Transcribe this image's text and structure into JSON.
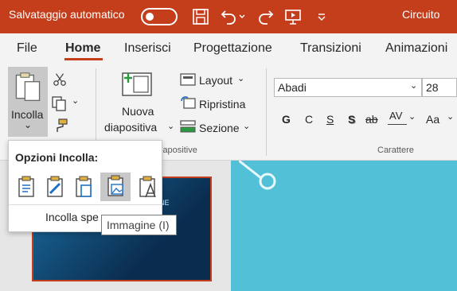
{
  "titlebar": {
    "autosave_label": "Salvataggio automatico",
    "autosave_state": "off",
    "doc_name": "Circuito"
  },
  "tabs": [
    {
      "label": "File"
    },
    {
      "label": "Home"
    },
    {
      "label": "Inserisci"
    },
    {
      "label": "Progettazione"
    },
    {
      "label": "Transizioni"
    },
    {
      "label": "Animazioni"
    }
  ],
  "ribbon": {
    "paste_label": "Incolla",
    "new_slide_line1": "Nuova",
    "new_slide_line2": "diapositiva",
    "layout_label": "Layout",
    "reset_label": "Ripristina",
    "section_label": "Sezione",
    "slides_group_label": "iapositive",
    "font_name": "Abadi",
    "font_size": "28",
    "font_group_label": "Carattere",
    "bold_label": "G",
    "italic_label": "C",
    "underline_label": "S",
    "shadow_label": "S",
    "strike_label": "ab",
    "spacing_label": "AV",
    "case_label": "Aa"
  },
  "paste_popup": {
    "title": "Opzioni Incolla:",
    "special_label": "Incolla spe"
  },
  "tooltip": {
    "text": "Immagine (I)"
  },
  "thumbnail": {
    "title_fragment": "NE"
  },
  "colors": {
    "accent": "#c43e1c",
    "slide_bg": "#52c1d8"
  }
}
